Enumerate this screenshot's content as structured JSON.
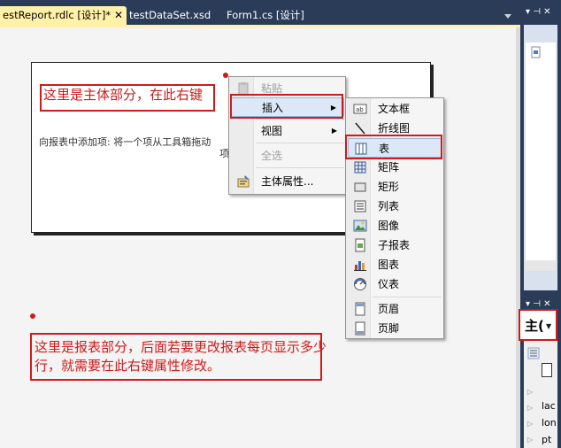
{
  "tabs": [
    {
      "label": "estReport.rdlc [设计]*",
      "close": "✕",
      "active": true
    },
    {
      "label": "testDataSet.xsd",
      "active": false
    },
    {
      "label": "Form1.cs [设计]",
      "active": false
    }
  ],
  "report_body": {
    "hint": "向报表中添加项: 将一个项从工具箱拖动",
    "hint_2": "项"
  },
  "annotations": {
    "body": "这里是主体部分，在此右键",
    "report": "这里是报表部分，后面若要更改报表每页显示多少行，就需要在此右键属性修改。"
  },
  "context_menu": {
    "items": [
      {
        "label": "粘贴",
        "icon": "paste-icon",
        "disabled": true
      },
      {
        "label": "插入",
        "icon": "",
        "submenu": true,
        "highlighted": true
      },
      {
        "label": "视图",
        "icon": "",
        "submenu": true
      },
      {
        "label": "全选",
        "icon": "",
        "disabled": true
      },
      {
        "label": "主体属性...",
        "icon": "properties-icon"
      }
    ]
  },
  "insert_menu": {
    "items": [
      {
        "label": "文本框",
        "icon": "textbox-icon"
      },
      {
        "label": "折线图",
        "icon": "line-icon"
      },
      {
        "label": "表",
        "icon": "table-icon",
        "highlighted": true
      },
      {
        "label": "矩阵",
        "icon": "matrix-icon"
      },
      {
        "label": "矩形",
        "icon": "rectangle-icon"
      },
      {
        "label": "列表",
        "icon": "list-icon"
      },
      {
        "label": "图像",
        "icon": "image-icon"
      },
      {
        "label": "子报表",
        "icon": "subreport-icon"
      },
      {
        "label": "图表",
        "icon": "chart-icon"
      },
      {
        "label": "仪表",
        "icon": "gauge-icon"
      },
      {
        "label": "页眉",
        "icon": "page-header-icon"
      },
      {
        "label": "页脚",
        "icon": "page-footer-icon"
      }
    ]
  },
  "right_panel": {
    "head_glyphs": "▾ ⊣ ✕",
    "combo_text": "主(",
    "props": [
      "lac",
      "lon",
      "pt"
    ]
  },
  "colors": {
    "chrome": "#2b3c59",
    "active_tab": "#fff1a8",
    "annotation": "#d01a1a",
    "menu_highlight": "#dce8f7"
  }
}
